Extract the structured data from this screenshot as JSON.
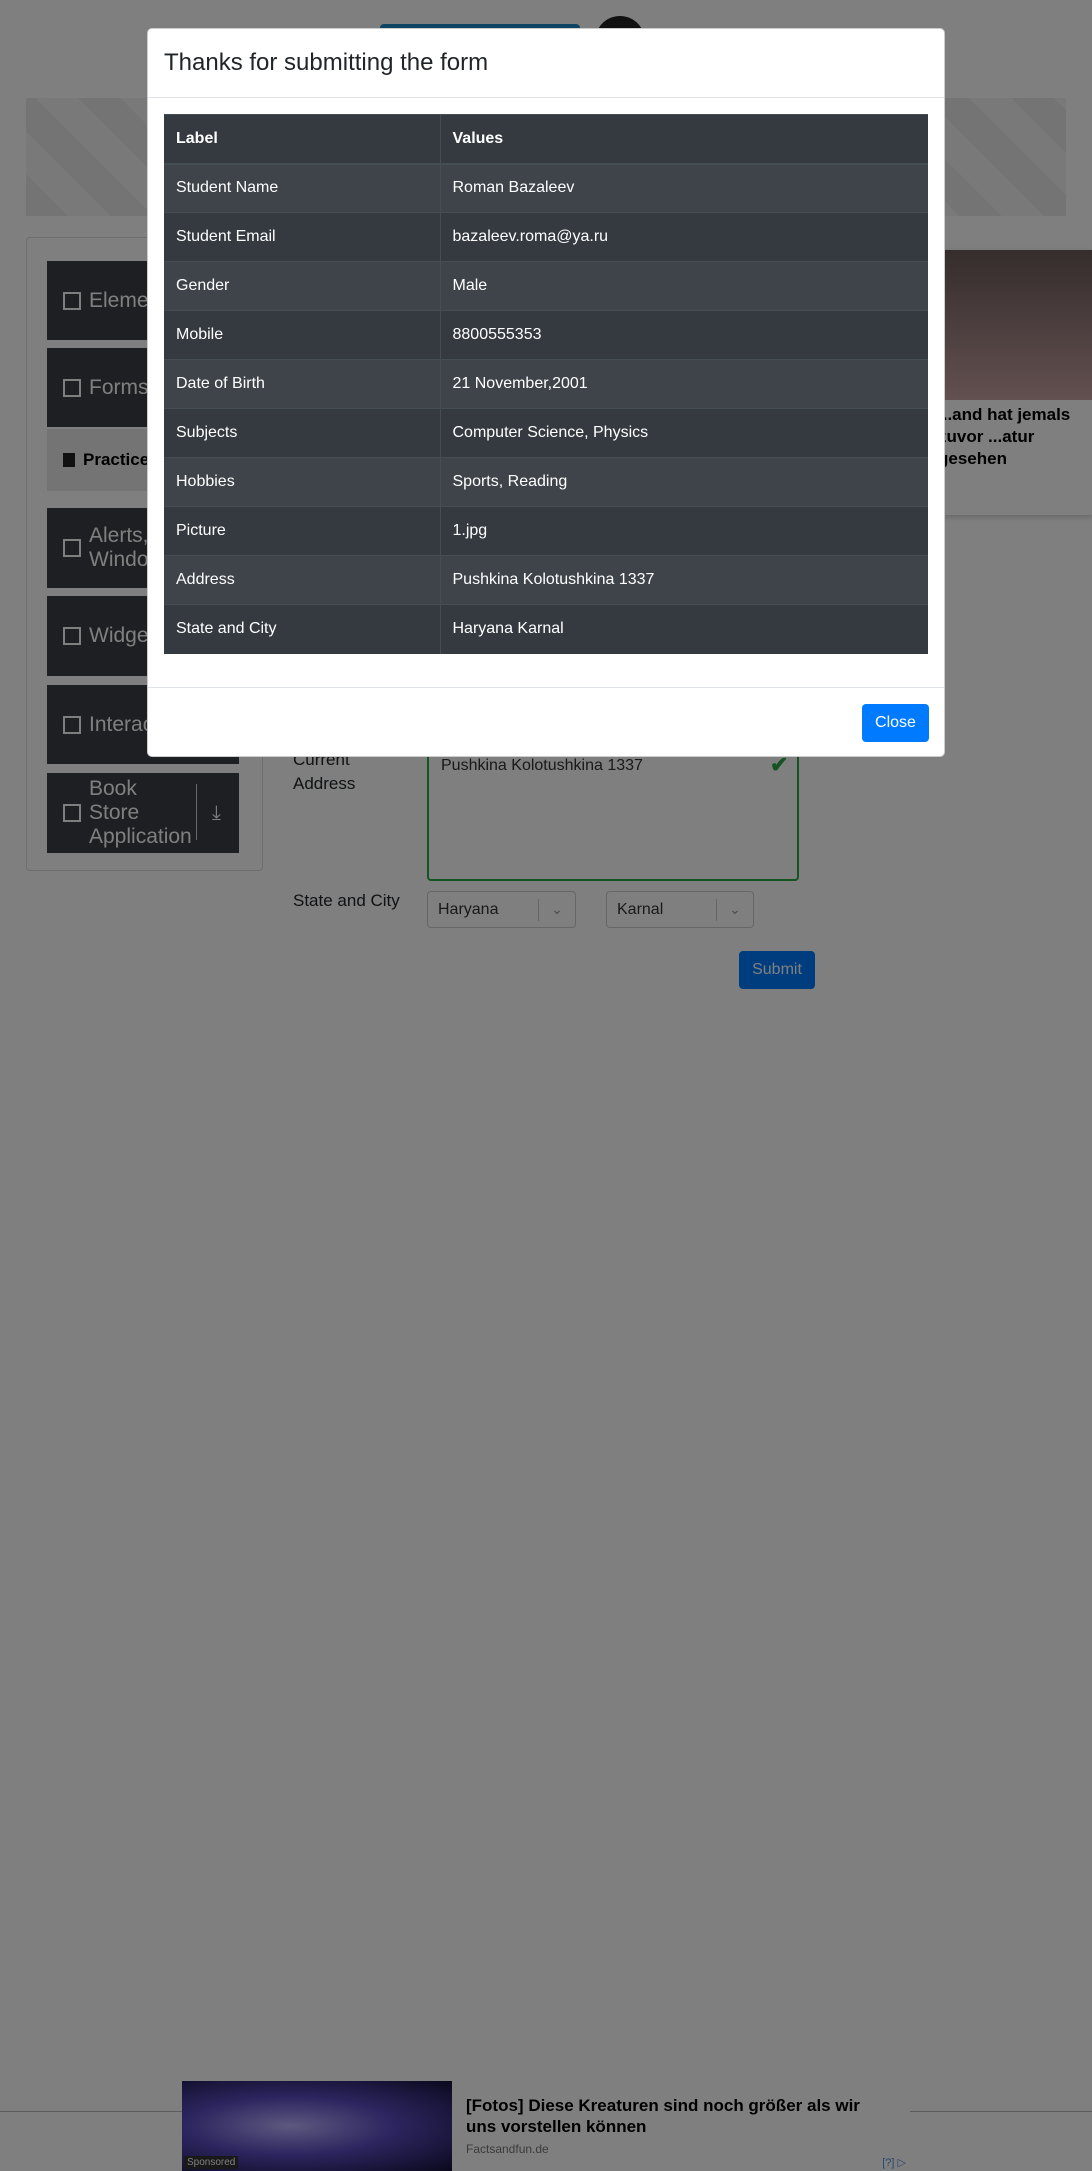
{
  "sidebar": {
    "groups": [
      {
        "label": "Elements"
      },
      {
        "label": "Forms"
      },
      {
        "label": "Alerts, Frame & Windows"
      },
      {
        "label": "Widgets"
      },
      {
        "label": "Interactions"
      },
      {
        "label": "Book Store Application"
      }
    ],
    "active_item": "Practice Form"
  },
  "right_ad": {
    "text": "...and hat jemals zuvor ...atur gesehen"
  },
  "form": {
    "current_address_label": "Current Address",
    "current_address_value": "Pushkina Kolotushkina 1337",
    "state_city_label": "State and City",
    "state": "Haryana",
    "city": "Karnal",
    "submit_label": "Submit"
  },
  "bottom_ad": {
    "sponsored": "Sponsored",
    "title": "[Fotos] Diese Kreaturen sind noch größer als wir uns vorstellen können",
    "source": "Factsandfun.de",
    "mark": "[?]"
  },
  "modal": {
    "title": "Thanks for submitting the form",
    "table": {
      "headers": [
        "Label",
        "Values"
      ],
      "rows": [
        [
          "Student Name",
          "Roman Bazaleev"
        ],
        [
          "Student Email",
          "bazaleev.roma@ya.ru"
        ],
        [
          "Gender",
          "Male"
        ],
        [
          "Mobile",
          "8800555353"
        ],
        [
          "Date of Birth",
          "21 November,2001"
        ],
        [
          "Subjects",
          "Computer Science, Physics"
        ],
        [
          "Hobbies",
          "Sports, Reading"
        ],
        [
          "Picture",
          "1.jpg"
        ],
        [
          "Address",
          "Pushkina Kolotushkina 1337"
        ],
        [
          "State and City",
          "Haryana Karnal"
        ]
      ]
    },
    "close_label": "Close"
  }
}
